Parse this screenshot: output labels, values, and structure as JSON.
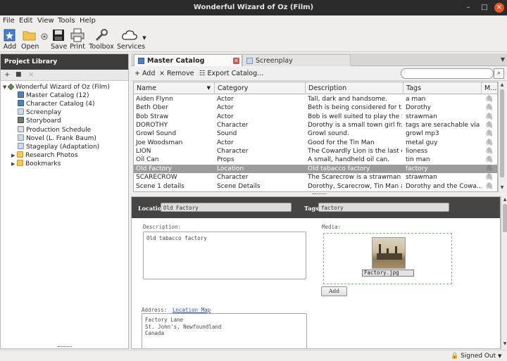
{
  "window": {
    "title": "Wonderful Wizard of Oz (Film)"
  },
  "menu": [
    "File",
    "Edit",
    "View",
    "Tools",
    "Help"
  ],
  "toolbar": {
    "add": "Add",
    "open": "Open",
    "save": "Save",
    "print": "Print",
    "toolbox": "Toolbox",
    "services": "Services"
  },
  "project_library": {
    "title": "Project Library",
    "tree": [
      {
        "label": "Wonderful Wizard of Oz (Film)",
        "icon": "project-icon",
        "expanded": true
      },
      {
        "label": "Master Catalog (12)",
        "icon": "catalog-icon"
      },
      {
        "label": "Character Catalog (4)",
        "icon": "catalog-icon"
      },
      {
        "label": "Screenplay",
        "icon": "document-icon"
      },
      {
        "label": "Storyboard",
        "icon": "storyboard-icon"
      },
      {
        "label": "Production Schedule",
        "icon": "schedule-icon"
      },
      {
        "label": "Novel (L. Frank Baum)",
        "icon": "document-icon"
      },
      {
        "label": "Stageplay (Adaptation)",
        "icon": "document-icon"
      },
      {
        "label": "Research Photos",
        "icon": "folder-icon",
        "expanded": false
      },
      {
        "label": "Bookmarks",
        "icon": "folder-icon",
        "expanded": false
      }
    ]
  },
  "tabs": [
    {
      "label": "Master Catalog",
      "active": true
    },
    {
      "label": "Screenplay",
      "active": false
    }
  ],
  "catalog_toolbar": {
    "add": "+ Add",
    "remove": "× Remove",
    "export": "Export Catalog..."
  },
  "catalog": {
    "columns": [
      "Name",
      "Category",
      "Description",
      "Tags",
      "M..."
    ],
    "rows": [
      {
        "name": "Aiden Flynn",
        "category": "Actor",
        "description": "Tall, dark and handsome.",
        "tags": "a man"
      },
      {
        "name": "Beth Ober",
        "category": "Actor",
        "description": "Beth is being considered for t...",
        "tags": "Dorothy"
      },
      {
        "name": "Bob Straw",
        "category": "Actor",
        "description": "Bob is well suited to play the S...",
        "tags": "strawman"
      },
      {
        "name": "DOROTHY",
        "category": "Character",
        "description": "Dorothy is a small town girl fr...",
        "tags": "tags are serachable via ..."
      },
      {
        "name": "Growl Sound",
        "category": "Sound",
        "description": "Growl sound.",
        "tags": "growl mp3"
      },
      {
        "name": "Joe Woodsman",
        "category": "Actor",
        "description": "Good for the Tin Man",
        "tags": "metal guy"
      },
      {
        "name": "LION",
        "category": "Character",
        "description": "The Cowardly Lion is the last o...",
        "tags": "lioness"
      },
      {
        "name": "Oil Can",
        "category": "Props",
        "description": "A small, handheld oil can.",
        "tags": "tin man"
      },
      {
        "name": "Old Factory",
        "category": "Location",
        "description": "Old tabacco factory",
        "tags": "factory",
        "selected": true
      },
      {
        "name": "SCARECROW",
        "category": "Character",
        "description": "The Scarecrow is a strawman i...",
        "tags": "strawman"
      },
      {
        "name": "Scene 1 details",
        "category": "Scene Details",
        "description": "Dorothy, Scarecrow, Tin Man a...",
        "tags": "Dorothy and the Cowa..."
      }
    ]
  },
  "detail": {
    "location_label": "Location:",
    "location_value": "Old Factory",
    "tags_label": "Tags:",
    "tags_value": "factory",
    "description_label": "Description:",
    "description_value": "Old tabacco factory",
    "media_label": "Media:",
    "media_filename": "Factory.jpg",
    "add_button": "Add",
    "address_label": "Address:",
    "location_map_link": "Location Map",
    "address_value": "Factory Lane\nSt. John's, Newfoundland\nCanada"
  },
  "status": {
    "signed": "Signed Out"
  }
}
